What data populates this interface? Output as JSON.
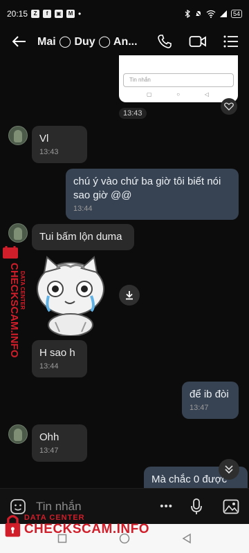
{
  "status": {
    "time": "20:15",
    "notif_icons": [
      "zalo-icon",
      "facebook-icon",
      "app-icon",
      "gmail-icon"
    ],
    "dot": "•",
    "battery": "54"
  },
  "header": {
    "title": "Mai ◯ Duy ◯ An..."
  },
  "image_card": {
    "placeholder": "Tin nhắn",
    "time": "13:43"
  },
  "messages": [
    {
      "dir": "in",
      "text": "Vl",
      "time": "13:43"
    },
    {
      "dir": "out",
      "text": "chú ý vào chứ ba giờ tôi biết nói sao giờ @@",
      "time": "13:44"
    },
    {
      "dir": "in",
      "text": "Tui bấm lộn duma",
      "time": ""
    },
    {
      "dir": "in",
      "text": "H sao h",
      "time": "13:44"
    },
    {
      "dir": "out",
      "text": "để ib đòi",
      "time": "13:47"
    },
    {
      "dir": "in",
      "text": "Ohh",
      "time": "13:47"
    },
    {
      "dir": "out",
      "text": "Mà chắc 0 được",
      "time": ""
    }
  ],
  "input": {
    "placeholder": "Tin nhắn",
    "more_label": "•••"
  },
  "watermark": {
    "small": "DATA CENTER",
    "big": "CHECKSCAM.INFO"
  },
  "colors": {
    "accent": "#d01e2a",
    "bubble_out": "#374352",
    "bubble_in": "#2a2a2a"
  }
}
